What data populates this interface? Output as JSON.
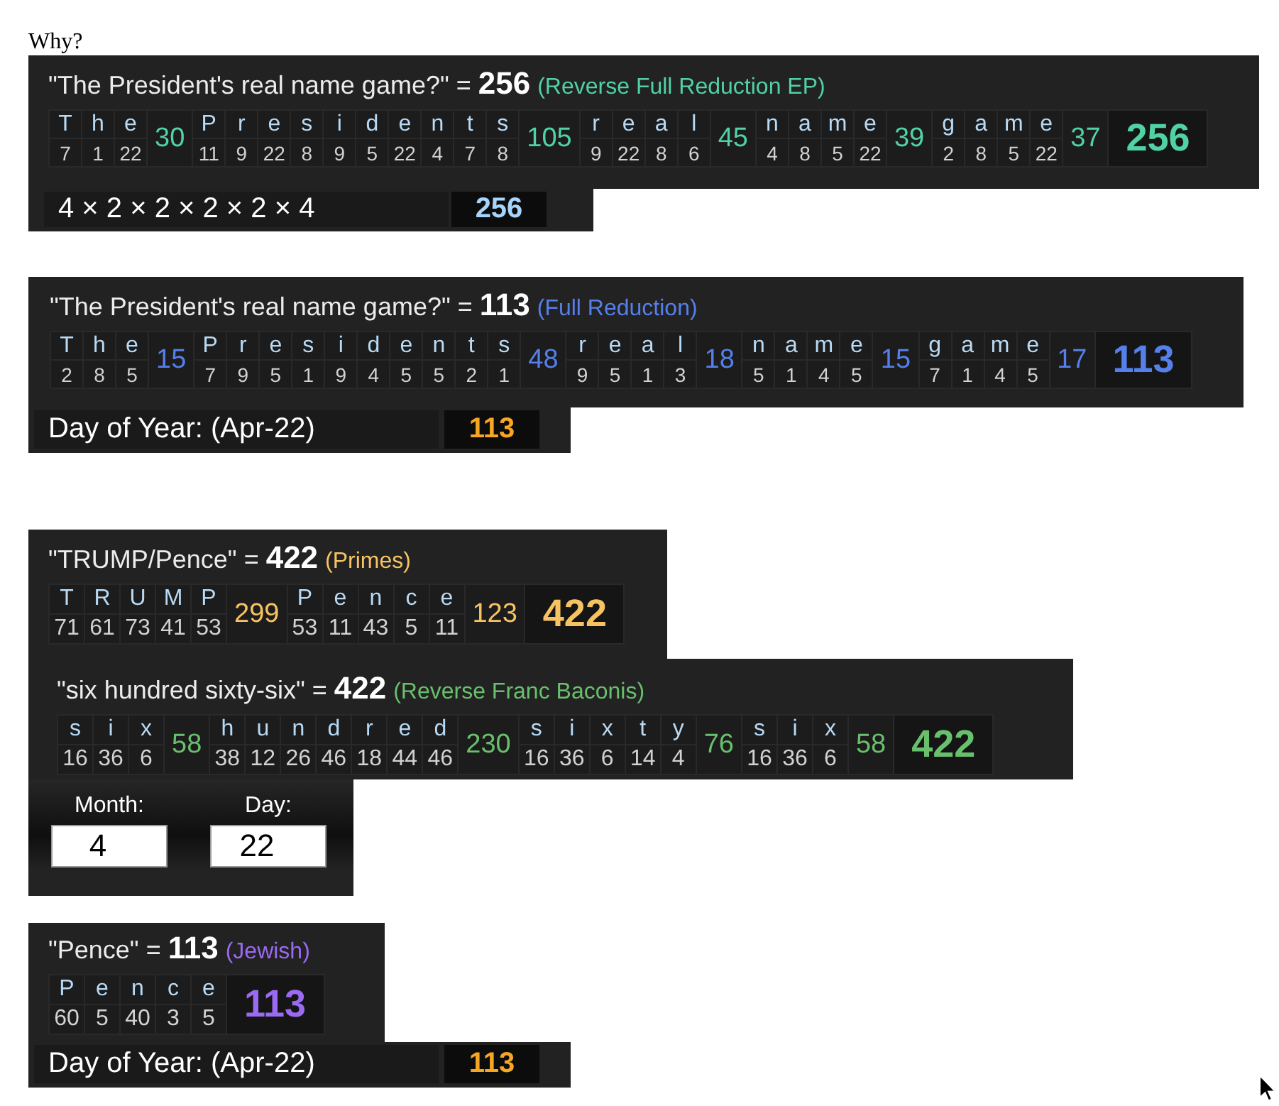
{
  "heading": "Why?",
  "results": [
    {
      "title": "\"The President's real name game?\" = **256**",
      "cipher": "(Reverse Full Reduction EP)",
      "color": "#50d2a4",
      "words": [
        {
          "letters": [
            {
              "char": "T",
              "value": "7"
            },
            {
              "char": "h",
              "value": "1"
            },
            {
              "char": "e",
              "value": "22"
            }
          ],
          "sum": "30"
        },
        {
          "letters": [
            {
              "char": "P",
              "value": "11"
            },
            {
              "char": "r",
              "value": "9"
            },
            {
              "char": "e",
              "value": "22"
            },
            {
              "char": "s",
              "value": "8"
            },
            {
              "char": "i",
              "value": "9"
            },
            {
              "char": "d",
              "value": "5"
            },
            {
              "char": "e",
              "value": "22"
            },
            {
              "char": "n",
              "value": "4"
            },
            {
              "char": "t",
              "value": "7"
            },
            {
              "char": "s",
              "value": "8"
            }
          ],
          "sum": "105"
        },
        {
          "letters": [
            {
              "char": "r",
              "value": "9"
            },
            {
              "char": "e",
              "value": "22"
            },
            {
              "char": "a",
              "value": "8"
            },
            {
              "char": "l",
              "value": "6"
            }
          ],
          "sum": "45"
        },
        {
          "letters": [
            {
              "char": "n",
              "value": "4"
            },
            {
              "char": "a",
              "value": "8"
            },
            {
              "char": "m",
              "value": "5"
            },
            {
              "char": "e",
              "value": "22"
            }
          ],
          "sum": "39"
        },
        {
          "letters": [
            {
              "char": "g",
              "value": "2"
            },
            {
              "char": "a",
              "value": "8"
            },
            {
              "char": "m",
              "value": "5"
            },
            {
              "char": "e",
              "value": "22"
            }
          ],
          "sum": "37"
        }
      ],
      "total": "256",
      "extra": {
        "kind": "product",
        "label": "4 × 2 × 2 × 2 × 2 × 4",
        "value": "256"
      }
    },
    {
      "title": "\"The President's real name game?\" = **113**",
      "cipher": "(Full Reduction)",
      "color": "#5580ec",
      "words": [
        {
          "letters": [
            {
              "char": "T",
              "value": "2"
            },
            {
              "char": "h",
              "value": "8"
            },
            {
              "char": "e",
              "value": "5"
            }
          ],
          "sum": "15"
        },
        {
          "letters": [
            {
              "char": "P",
              "value": "7"
            },
            {
              "char": "r",
              "value": "9"
            },
            {
              "char": "e",
              "value": "5"
            },
            {
              "char": "s",
              "value": "1"
            },
            {
              "char": "i",
              "value": "9"
            },
            {
              "char": "d",
              "value": "4"
            },
            {
              "char": "e",
              "value": "5"
            },
            {
              "char": "n",
              "value": "5"
            },
            {
              "char": "t",
              "value": "2"
            },
            {
              "char": "s",
              "value": "1"
            }
          ],
          "sum": "48"
        },
        {
          "letters": [
            {
              "char": "r",
              "value": "9"
            },
            {
              "char": "e",
              "value": "5"
            },
            {
              "char": "a",
              "value": "1"
            },
            {
              "char": "l",
              "value": "3"
            }
          ],
          "sum": "18"
        },
        {
          "letters": [
            {
              "char": "n",
              "value": "5"
            },
            {
              "char": "a",
              "value": "1"
            },
            {
              "char": "m",
              "value": "4"
            },
            {
              "char": "e",
              "value": "5"
            }
          ],
          "sum": "15"
        },
        {
          "letters": [
            {
              "char": "g",
              "value": "7"
            },
            {
              "char": "a",
              "value": "1"
            },
            {
              "char": "m",
              "value": "4"
            },
            {
              "char": "e",
              "value": "5"
            }
          ],
          "sum": "17"
        }
      ],
      "total": "113",
      "extra": {
        "kind": "day_of_year",
        "label": "Day of Year: (Apr-22)",
        "value": "113"
      }
    },
    {
      "title": "\"TRUMP/Pence\" = **422**",
      "cipher": "(Primes)",
      "color": "#f7c362",
      "words": [
        {
          "letters": [
            {
              "char": "T",
              "value": "71"
            },
            {
              "char": "R",
              "value": "61"
            },
            {
              "char": "U",
              "value": "73"
            },
            {
              "char": "M",
              "value": "41"
            },
            {
              "char": "P",
              "value": "53"
            }
          ],
          "sum": "299"
        },
        {
          "letters": [
            {
              "char": "P",
              "value": "53"
            },
            {
              "char": "e",
              "value": "11"
            },
            {
              "char": "n",
              "value": "43"
            },
            {
              "char": "c",
              "value": "5"
            },
            {
              "char": "e",
              "value": "11"
            }
          ],
          "sum": "123"
        }
      ],
      "total": "422"
    },
    {
      "title": "\"six hundred sixty-six\" = **422**",
      "cipher": "(Reverse Franc Baconis)",
      "color": "#68c06c",
      "words": [
        {
          "letters": [
            {
              "char": "s",
              "value": "16"
            },
            {
              "char": "i",
              "value": "36"
            },
            {
              "char": "x",
              "value": "6"
            }
          ],
          "sum": "58"
        },
        {
          "letters": [
            {
              "char": "h",
              "value": "38"
            },
            {
              "char": "u",
              "value": "12"
            },
            {
              "char": "n",
              "value": "26"
            },
            {
              "char": "d",
              "value": "46"
            },
            {
              "char": "r",
              "value": "18"
            },
            {
              "char": "e",
              "value": "44"
            },
            {
              "char": "d",
              "value": "46"
            }
          ],
          "sum": "230"
        },
        {
          "letters": [
            {
              "char": "s",
              "value": "16"
            },
            {
              "char": "i",
              "value": "36"
            },
            {
              "char": "x",
              "value": "6"
            },
            {
              "char": "t",
              "value": "14"
            },
            {
              "char": "y",
              "value": "4"
            }
          ],
          "sum": "76"
        },
        {
          "letters": [
            {
              "char": "s",
              "value": "16"
            },
            {
              "char": "i",
              "value": "36"
            },
            {
              "char": "x",
              "value": "6"
            }
          ],
          "sum": "58"
        }
      ],
      "total": "422",
      "extra": {
        "kind": "date_inputs",
        "fields": [
          {
            "label": "Month:",
            "value": "4"
          },
          {
            "label": "Day:",
            "value": "22"
          }
        ]
      }
    },
    {
      "title": "\"Pence\" = **113**",
      "cipher": "(Jewish)",
      "color": "#9b6af2",
      "words": [
        {
          "letters": [
            {
              "char": "P",
              "value": "60"
            },
            {
              "char": "e",
              "value": "5"
            },
            {
              "char": "n",
              "value": "40"
            },
            {
              "char": "c",
              "value": "3"
            },
            {
              "char": "e",
              "value": "5"
            }
          ]
        }
      ],
      "total": "113",
      "extra": {
        "kind": "day_of_year",
        "label": "Day of Year: (Apr-22)",
        "value": "113"
      }
    }
  ]
}
